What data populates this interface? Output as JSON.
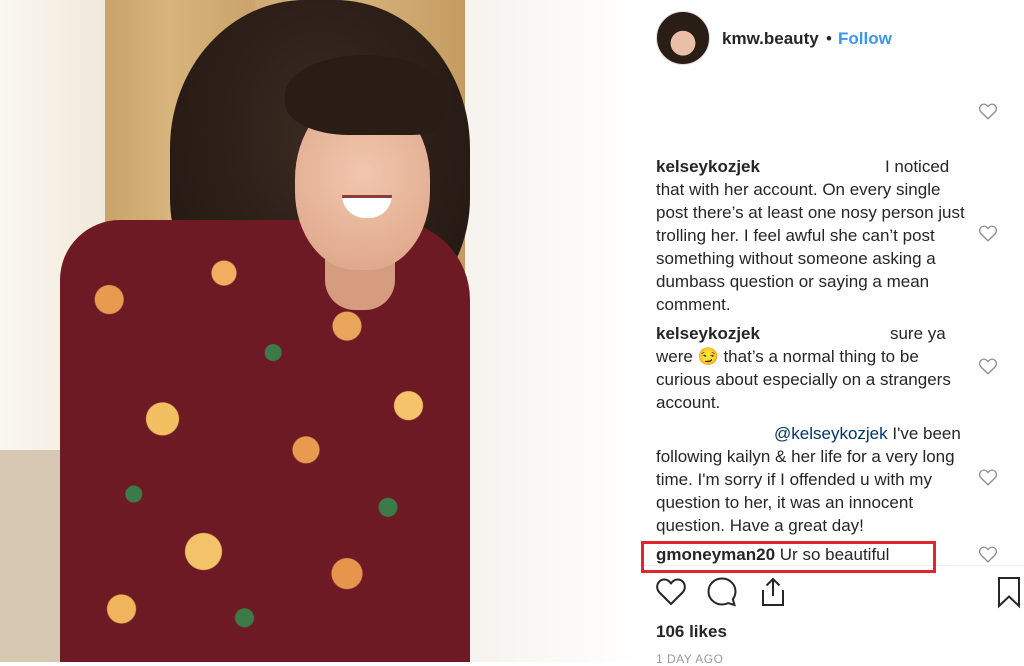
{
  "post": {
    "author": "kmw.beauty",
    "separator": "•",
    "follow_label": "Follow"
  },
  "comments": [
    {
      "user": "kelseykozjek",
      "text_before": "",
      "mention": "",
      "text": "I noticed that with her account. On every single post there’s at least one nosy person just trolling her. I feel awful she can’t post something without someone asking a dumbass question or saying a mean comment."
    },
    {
      "user": "kelseykozjek",
      "text": "sure ya were 😏 that’s a normal thing to be curious about especially on a strangers account."
    },
    {
      "user": "",
      "mention": "@kelseykozjek",
      "text": "I've been following kailyn & her life for a very long time. I'm sorry if I offended u with my question to her, it was an innocent question. Have a great day!"
    },
    {
      "user": "gmoneyman20",
      "text": "Ur so beautiful"
    }
  ],
  "likes_text": "106 likes",
  "timestamp": "1 DAY AGO",
  "icons": {
    "comment_like": "heart-outline-icon",
    "like": "heart-icon",
    "comment": "speech-bubble-icon",
    "share": "share-icon",
    "save": "bookmark-icon"
  },
  "colors": {
    "follow": "#3897f0",
    "highlight_border": "#e0262e",
    "mention": "#003569"
  }
}
